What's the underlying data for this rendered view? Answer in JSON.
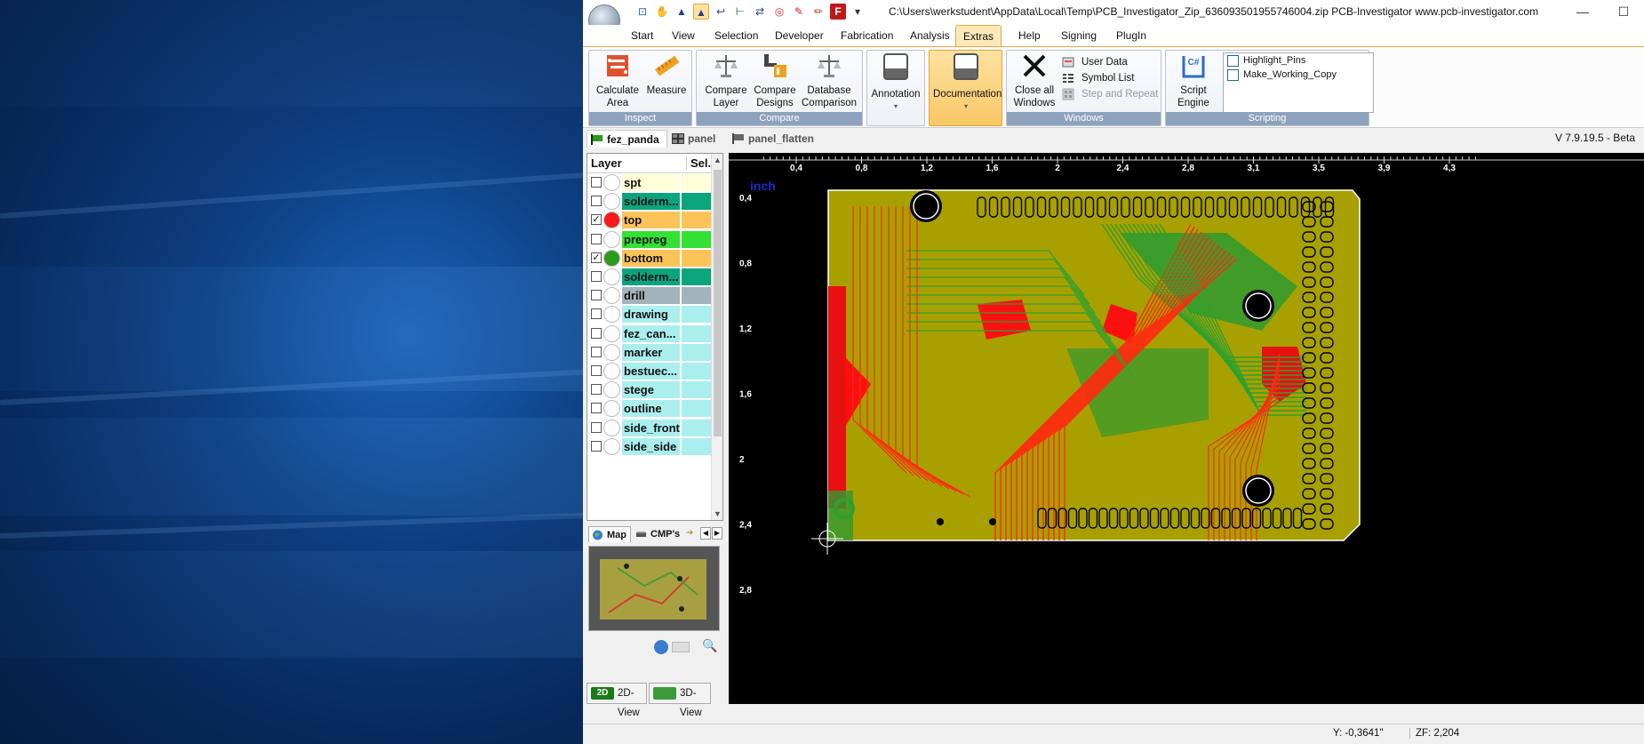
{
  "window": {
    "title": "C:\\Users\\werkstudent\\AppData\\Local\\Temp\\PCB_Investigator_Zip_636093501955746004.zip   PCB-Investigator    www.pcb-investigator.com",
    "minimize_icon": "minimize-icon",
    "maximize_icon": "maximize-icon"
  },
  "tabs": [
    "Start",
    "View",
    "Selection",
    "Developer",
    "Fabrication",
    "Analysis",
    "Extras",
    "Help",
    "Signing",
    "PlugIn"
  ],
  "active_tab": "Extras",
  "ribbon": {
    "inspect": {
      "label": "Inspect",
      "calculate_area": "Calculate\nArea",
      "measure": "Measure"
    },
    "compare": {
      "label": "Compare",
      "compare_layer": "Compare\nLayer",
      "compare_designs": "Compare\nDesigns",
      "database_comparison": "Database\nComparison"
    },
    "annotation": {
      "label": "Annotation"
    },
    "documentation": {
      "label": "Documentation"
    },
    "windows": {
      "label": "Windows",
      "close_all": "Close all\nWindows",
      "user_data": "User Data",
      "symbol_list": "Symbol List",
      "step_and_repeat": "Step and Repeat"
    },
    "scripting": {
      "label": "Scripting",
      "script_engine": "Script\nEngine",
      "scripts": [
        "Highlight_Pins",
        "Make_Working_Copy"
      ]
    }
  },
  "doc_tabs": [
    "fez_panda",
    "panel",
    "panel_flatten"
  ],
  "version": "V 7.9.19.5 - Beta",
  "layer_panel": {
    "col_layer": "Layer",
    "col_sel": "Sel.",
    "layers": [
      {
        "name": "spt",
        "checked": false,
        "dot": "#ffffff",
        "bg": "#fffdd8"
      },
      {
        "name": "solderm...",
        "checked": false,
        "dot": "#ffffff",
        "bg": "#0aa57c"
      },
      {
        "name": "top",
        "checked": true,
        "dot": "#ff1a1a",
        "bg": "#fcc458"
      },
      {
        "name": "prepreg",
        "checked": false,
        "dot": "#ffffff",
        "bg": "#33e033"
      },
      {
        "name": "bottom",
        "checked": true,
        "dot": "#2c9a1c",
        "bg": "#fcc458"
      },
      {
        "name": "solderm...",
        "checked": false,
        "dot": "#ffffff",
        "bg": "#0aa57c"
      },
      {
        "name": "drill",
        "checked": false,
        "dot": "#ffffff",
        "bg": "#a3b3bd"
      },
      {
        "name": "drawing",
        "checked": false,
        "dot": "#ffffff",
        "bg": "#aaeeee"
      },
      {
        "name": "fez_can...",
        "checked": false,
        "dot": "#ffffff",
        "bg": "#aaeeee"
      },
      {
        "name": "marker",
        "checked": false,
        "dot": "#ffffff",
        "bg": "#aaeeee"
      },
      {
        "name": "bestuec...",
        "checked": false,
        "dot": "#ffffff",
        "bg": "#aaeeee"
      },
      {
        "name": "stege",
        "checked": false,
        "dot": "#ffffff",
        "bg": "#aaeeee"
      },
      {
        "name": "outline",
        "checked": false,
        "dot": "#ffffff",
        "bg": "#aaeeee"
      },
      {
        "name": "side_front",
        "checked": false,
        "dot": "#ffffff",
        "bg": "#aaeeee"
      },
      {
        "name": "side_side",
        "checked": false,
        "dot": "#ffffff",
        "bg": "#aaeeee"
      }
    ]
  },
  "map_panel": {
    "tab_map": "Map",
    "tab_cmps": "CMP's"
  },
  "views": {
    "btn_2d": "2D-View",
    "btn_3d": "3D-View",
    "badge_2d": "2D"
  },
  "canvas": {
    "unit": "inch",
    "x_ticks": [
      "0,4",
      "0,8",
      "1,2",
      "1,6",
      "2",
      "2,4",
      "2,8",
      "3,1",
      "3,5",
      "3,9",
      "4,3"
    ],
    "y_ticks": [
      "0,4",
      "0,8",
      "1,2",
      "1,6",
      "2",
      "2,4",
      "2,8"
    ]
  },
  "status": {
    "y_coord": "Y: -0,3641\"",
    "zoom": "ZF: 2,204"
  }
}
